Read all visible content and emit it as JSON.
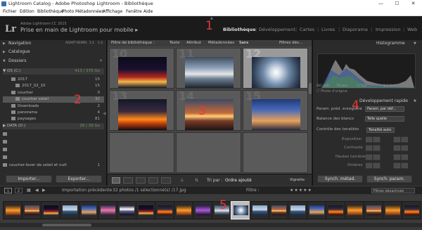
{
  "window": {
    "title": "Lightroom Catalog - Adobe Photoshop Lightroom - Bibliothèque",
    "controls": [
      "—",
      "☐",
      "✕"
    ]
  },
  "menu": [
    "Fichier",
    "Edition",
    "Bibliothèque",
    "Photo",
    "Métadonnées",
    "Affichage",
    "Fenêtre",
    "Aide"
  ],
  "identity": {
    "logo": "Lr",
    "product": "Adobe Lightroom CC 2015",
    "subtitle": "Prise en main de Lightroom pour mobile ▸"
  },
  "modules": [
    "Bibliothèque",
    "Développement",
    "Cartes",
    "Livres",
    "Diaporama",
    "Impression",
    "Web"
  ],
  "module_active_index": 0,
  "callouts": [
    "1",
    "2",
    "3",
    "4",
    "5"
  ],
  "left_panel": {
    "navigator": {
      "label": "Navigation",
      "opts": [
        "ADAPT",
        "REMPL",
        "1:1",
        "1:3"
      ]
    },
    "catalog": {
      "label": "Catalogue"
    },
    "folders": {
      "label": "Dossiers",
      "add": "+"
    },
    "volume_os": {
      "label": "OS (C:)",
      "stat": "413 / 376 Go"
    },
    "folder_rows": [
      {
        "name": "2017",
        "count": "15",
        "indent": 1
      },
      {
        "name": "2017_02_10",
        "count": "15",
        "indent": 2
      },
      {
        "name": "coucher",
        "count": "0",
        "indent": 1
      },
      {
        "name": "coucher soleil",
        "count": "32",
        "indent": 2
      },
      {
        "name": "Downloads",
        "count": "2",
        "indent": 1
      },
      {
        "name": "panorama",
        "count": "4",
        "indent": 1
      },
      {
        "name": "paysages",
        "count": "81",
        "indent": 1
      }
    ],
    "volume_data": {
      "label": "DATA (D:)",
      "stat": "28 / 39 Go"
    },
    "last_folder": {
      "name": "coucher-lever de soleil et nuit",
      "count": "1"
    },
    "import_label": "Importer...",
    "export_label": "Exporter..."
  },
  "filter_bar": {
    "title": "Filtre de bibliothèque :",
    "tabs": [
      "Texte",
      "Attribut",
      "Métadonnées",
      "Sans"
    ],
    "active_tab": "Sans",
    "presets": "Filtres dés..."
  },
  "grid": {
    "cells": [
      {
        "num": "10",
        "selected": false,
        "thumb": "city"
      },
      {
        "num": "11",
        "selected": false,
        "thumb": "clouds"
      },
      {
        "num": "12",
        "selected": true,
        "thumb": "sunburst"
      },
      {
        "num": "13",
        "selected": false,
        "thumb": "orange"
      },
      {
        "num": "14",
        "selected": false,
        "thumb": "sunset"
      },
      {
        "num": "15",
        "selected": false,
        "thumb": "blue"
      }
    ]
  },
  "toolbar": {
    "sort_label": "Tri par :",
    "sort_value": "Ordre ajouté",
    "thumbs_label": "Vignette"
  },
  "right_panel": {
    "histogram": {
      "label": "Histogramme",
      "iso": "ISO 200",
      "focal": "70 mm",
      "aperture": "f / 5,6",
      "shutter": "1/800 s",
      "original": "Photo d'origine"
    },
    "quick_develop": {
      "label": "Développement rapide",
      "saved_preset": "Param. préd. enregistré",
      "saved_preset_value": "Param. par déf...",
      "wb": "Balance des blancs",
      "wb_value": "Telle quelle",
      "tone": "Contrôle des tonalités",
      "tone_value": "Tonalité auto",
      "sliders": [
        "Exposition",
        "Contraste",
        "Hautes lumières",
        "Ombres"
      ]
    },
    "sync_meta": "Synch. métad.",
    "sync_settings": "Synch. param."
  },
  "filmstrip": {
    "import": "Importation précédente",
    "count": "32 photos /1 sélectionné(s) /17.jpg",
    "filter": "Filtre :",
    "filter_value": "Filtres désactivés",
    "pages": [
      "1",
      "2"
    ],
    "thumbs": [
      "sun",
      "sunset",
      "city",
      "sea",
      "blue",
      "pink",
      "wheel",
      "city",
      "orange",
      "sun",
      "purple",
      "clouds",
      "sunburst",
      "sea",
      "sunset",
      "sea",
      "blue",
      "orange",
      "sun",
      "sunset",
      "sun",
      "orange"
    ],
    "selected_index": 12
  }
}
